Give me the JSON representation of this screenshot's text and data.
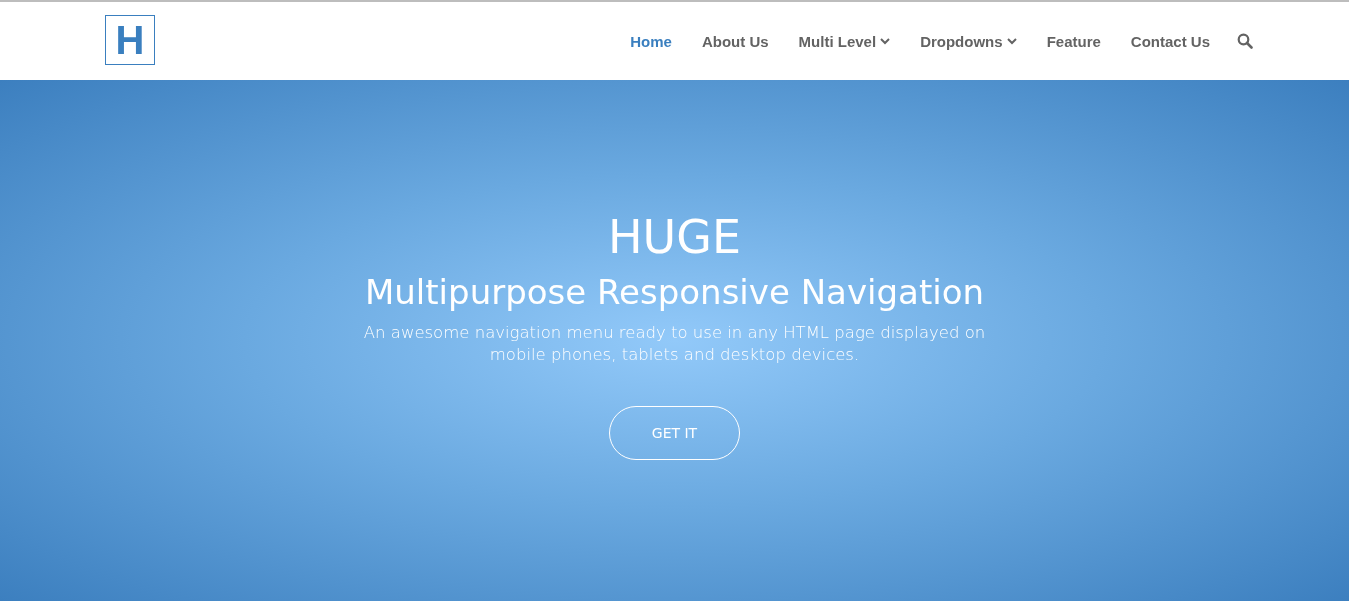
{
  "logo": {
    "letter": "H"
  },
  "nav": {
    "items": [
      {
        "label": "Home",
        "selected": true,
        "has_dropdown": false
      },
      {
        "label": "About Us",
        "selected": false,
        "has_dropdown": false
      },
      {
        "label": "Multi Level",
        "selected": false,
        "has_dropdown": true
      },
      {
        "label": "Dropdowns",
        "selected": false,
        "has_dropdown": true
      },
      {
        "label": "Feature",
        "selected": false,
        "has_dropdown": false
      },
      {
        "label": "Contact Us",
        "selected": false,
        "has_dropdown": false
      }
    ]
  },
  "hero": {
    "title": "HUGE",
    "subtitle": "Multipurpose Responsive Navigation",
    "description": "An awesome navigation menu ready to use in any HTML page displayed on mobile phones, tablets and desktop devices.",
    "button": "GET IT"
  }
}
